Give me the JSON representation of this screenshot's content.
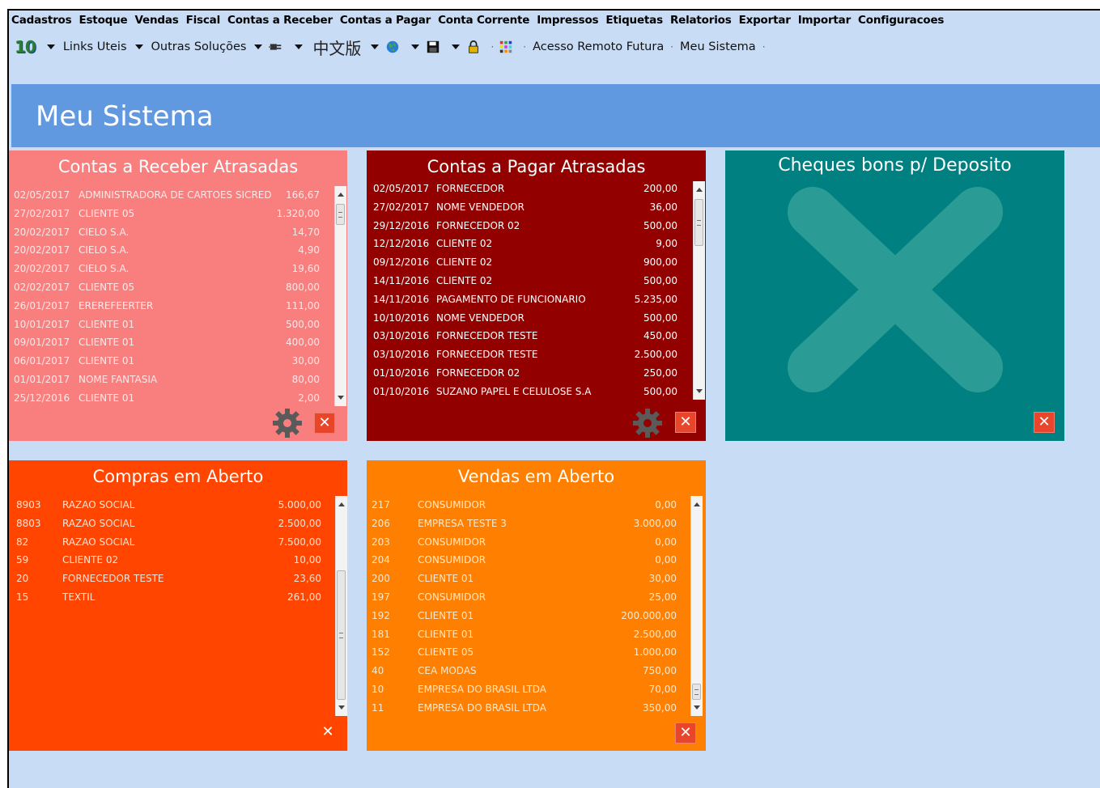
{
  "menubar": [
    "Cadastros",
    "Estoque",
    "Vendas",
    "Fiscal",
    "Contas a Receber",
    "Contas a Pagar",
    "Conta Corrente",
    "Impressos",
    "Etiquetas",
    "Relatorios",
    "Exportar",
    "Importar",
    "Configuracoes"
  ],
  "toolbar": {
    "logo": "10",
    "links_uteis": "Links Uteis",
    "outras_solucoes": "Outras Soluções",
    "chinese": "中文版",
    "acesso_remoto": "Acesso Remoto Futura",
    "meu_sistema": "Meu Sistema"
  },
  "page": {
    "title": "Meu Sistema"
  },
  "colors": {
    "background": "#c8dcf5",
    "header": "#6199e0",
    "receber": "#f97f7f",
    "pagar": "#930000",
    "cheques": "#008080",
    "compras": "#ff4500",
    "vendas": "#ff7f00",
    "close": "#e9452a"
  },
  "panels": {
    "receber": {
      "title": "Contas a Receber Atrasadas",
      "rows": [
        {
          "date": "02/05/2017",
          "name": "ADMINISTRADORA DE CARTOES SICRED",
          "value": "166,67"
        },
        {
          "date": "27/02/2017",
          "name": "CLIENTE 05",
          "value": "1.320,00"
        },
        {
          "date": "20/02/2017",
          "name": "CIELO S.A.",
          "value": "14,70"
        },
        {
          "date": "20/02/2017",
          "name": "CIELO S.A.",
          "value": "4,90"
        },
        {
          "date": "20/02/2017",
          "name": "CIELO S.A.",
          "value": "19,60"
        },
        {
          "date": "02/02/2017",
          "name": "CLIENTE 05",
          "value": "800,00"
        },
        {
          "date": "26/01/2017",
          "name": "EREREFEERTER",
          "value": "111,00"
        },
        {
          "date": "10/01/2017",
          "name": "CLIENTE 01",
          "value": "500,00"
        },
        {
          "date": "09/01/2017",
          "name": "CLIENTE 01",
          "value": "400,00"
        },
        {
          "date": "06/01/2017",
          "name": "CLIENTE 01",
          "value": "30,00"
        },
        {
          "date": "01/01/2017",
          "name": "NOME FANTASIA",
          "value": "80,00"
        },
        {
          "date": "25/12/2016",
          "name": "CLIENTE 01",
          "value": "2,00"
        }
      ]
    },
    "pagar": {
      "title": "Contas a Pagar Atrasadas",
      "rows": [
        {
          "date": "02/05/2017",
          "name": "FORNECEDOR",
          "value": "200,00"
        },
        {
          "date": "27/02/2017",
          "name": "NOME VENDEDOR",
          "value": "36,00"
        },
        {
          "date": "29/12/2016",
          "name": "FORNECEDOR 02",
          "value": "500,00"
        },
        {
          "date": "12/12/2016",
          "name": "CLIENTE 02",
          "value": "9,00"
        },
        {
          "date": "09/12/2016",
          "name": "CLIENTE 02",
          "value": "900,00"
        },
        {
          "date": "14/11/2016",
          "name": "CLIENTE 02",
          "value": "500,00"
        },
        {
          "date": "14/11/2016",
          "name": "PAGAMENTO DE FUNCIONARIO",
          "value": "5.235,00"
        },
        {
          "date": "10/10/2016",
          "name": "NOME VENDEDOR",
          "value": "500,00"
        },
        {
          "date": "03/10/2016",
          "name": "FORNECEDOR TESTE",
          "value": "450,00"
        },
        {
          "date": "03/10/2016",
          "name": "FORNECEDOR TESTE",
          "value": "2.500,00"
        },
        {
          "date": "01/10/2016",
          "name": "FORNECEDOR 02",
          "value": "250,00"
        },
        {
          "date": "01/10/2016",
          "name": "SUZANO PAPEL E CELULOSE S.A",
          "value": "500,00"
        }
      ]
    },
    "cheques": {
      "title": "Cheques bons p/ Deposito"
    },
    "compras": {
      "title": "Compras em Aberto",
      "rows": [
        {
          "id": "8903",
          "name": "RAZAO SOCIAL",
          "value": "5.000,00"
        },
        {
          "id": "8803",
          "name": "RAZAO SOCIAL",
          "value": "2.500,00"
        },
        {
          "id": "82",
          "name": "RAZAO SOCIAL",
          "value": "7.500,00"
        },
        {
          "id": "59",
          "name": "CLIENTE 02",
          "value": "10,00"
        },
        {
          "id": "20",
          "name": "FORNECEDOR TESTE",
          "value": "23,60"
        },
        {
          "id": "15",
          "name": "TEXTIL",
          "value": "261,00"
        }
      ]
    },
    "vendas": {
      "title": "Vendas em Aberto",
      "rows": [
        {
          "id": "217",
          "name": "CONSUMIDOR",
          "value": "0,00"
        },
        {
          "id": "206",
          "name": "EMPRESA TESTE 3",
          "value": "3.000,00"
        },
        {
          "id": "203",
          "name": "CONSUMIDOR",
          "value": "0,00"
        },
        {
          "id": "204",
          "name": "CONSUMIDOR",
          "value": "0,00"
        },
        {
          "id": "200",
          "name": "CLIENTE 01",
          "value": "30,00"
        },
        {
          "id": "197",
          "name": "CONSUMIDOR",
          "value": "25,00"
        },
        {
          "id": "192",
          "name": "CLIENTE 01",
          "value": "200.000,00"
        },
        {
          "id": "181",
          "name": "CLIENTE 01",
          "value": "2.500,00"
        },
        {
          "id": "152",
          "name": "CLIENTE 05",
          "value": "1.000,00"
        },
        {
          "id": "40",
          "name": "CEA MODAS",
          "value": "750,00"
        },
        {
          "id": "10",
          "name": "EMPRESA DO BRASIL LTDA",
          "value": "70,00"
        },
        {
          "id": "11",
          "name": "EMPRESA DO BRASIL LTDA",
          "value": "350,00"
        }
      ]
    }
  },
  "icons": [
    "dropdown-caret-icon",
    "plug-icon",
    "globe-icon",
    "floppy-disk-icon",
    "padlock-icon",
    "grid-icon",
    "gear-icon",
    "close-icon",
    "big-x-icon"
  ]
}
